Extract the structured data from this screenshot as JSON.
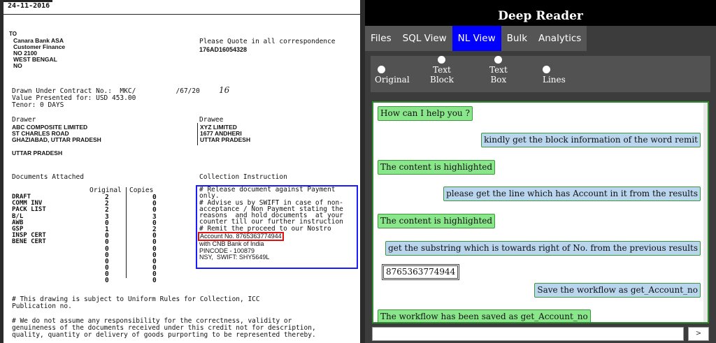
{
  "document": {
    "date": "24-11-2016",
    "to_label": "TO",
    "to_lines": [
      "Canara Bank ASA",
      "Customer Finance",
      "NO 2100",
      "WEST BENGAL",
      "NO"
    ],
    "quote_label": "Please Quote in all correspondence",
    "quote_ref": "176AD16054328",
    "contract_line": "Drawn Under Contract No.:  MKC/          /67/20",
    "contract_year": "16",
    "value_line": "Value Presented for: USD 453.00",
    "tenor_line": "Tenor: 0 DAYS",
    "drawer_label": "Drawer",
    "drawer_lines": [
      "ABC COMPOSITE LIMITED",
      "ST CHARLES ROAD",
      "GHAZIABAD, UTTAR PRADESH"
    ],
    "drawer_state": "UTTAR PRADESH",
    "drawee_label": "Drawee",
    "drawee_lines": [
      "XYZ LIMITED",
      "1677 ANDHERI",
      "UTTAR PRADESH"
    ],
    "docs_label": "Documents Attached",
    "collection_label": "Collection Instruction",
    "col_original": "Original",
    "col_copies": "Copies",
    "items": [
      "DRAFT",
      "COMM INV",
      "PACK LIST",
      "B/L",
      "AWB",
      "GSP",
      "INSP CERT",
      "BENE CERT"
    ],
    "originals": [
      "2",
      "2",
      "2",
      "3",
      "0",
      "1",
      "0",
      "0",
      "0",
      "0",
      "0",
      "0",
      "0",
      "0"
    ],
    "copies": [
      "0",
      "0",
      "0",
      "3",
      "0",
      "2",
      "0",
      "0",
      "0",
      "0",
      "0",
      "0",
      "0",
      "0"
    ],
    "instructions": [
      "# Release document against Payment",
      "only.",
      "# Advise us by SWIFT in case of non-",
      "acceptance / Non Payment stating the",
      "reasons  and hold documents  at your",
      "counter till our further instruction",
      "# Remit the proceed to our Nostro"
    ],
    "account_line": "Account No. 8765363774944",
    "instructions_after": [
      "with CNB Bank of India",
      "PINCODE - 100879",
      "NSY,  SWIFT: SHY5649L"
    ],
    "footer1": "# This drawing is subject to Uniform Rules for Collection, ICC",
    "footer1b": "Publication no.",
    "footer2": "# We do not assume any responsibility for the correctness, validity or",
    "footer2b": "genuineness of the documents received under this credit not for description,",
    "footer2c": "quality, quantity or delivery of goods purporting to be represented thereby."
  },
  "app": {
    "title": "Deep Reader",
    "tabs": [
      {
        "label": "Files"
      },
      {
        "label": "SQL View"
      },
      {
        "label": "NL View"
      },
      {
        "label": "Bulk"
      },
      {
        "label": "Analytics"
      }
    ],
    "view_options": [
      {
        "label": "Original"
      },
      {
        "label1": "Text",
        "label2": "Block"
      },
      {
        "label1": "Text",
        "label2": "Box"
      },
      {
        "label": "Lines"
      }
    ],
    "messages": [
      {
        "text": "How can I help you ?"
      },
      {
        "text": "kindly get the block information of the word remit"
      },
      {
        "text": "The content is highlighted"
      },
      {
        "text": "please get the line which has Account in it from the results"
      },
      {
        "text": "The content is highlighted"
      },
      {
        "text": "get the substring which is towards right of No. from the previous results"
      },
      {
        "text": "8765363774944"
      },
      {
        "text": "Save the workflow as get_Account_no"
      },
      {
        "text": "The workflow has been saved as get_Account_no"
      }
    ],
    "input_value": "",
    "send_label": ">"
  }
}
